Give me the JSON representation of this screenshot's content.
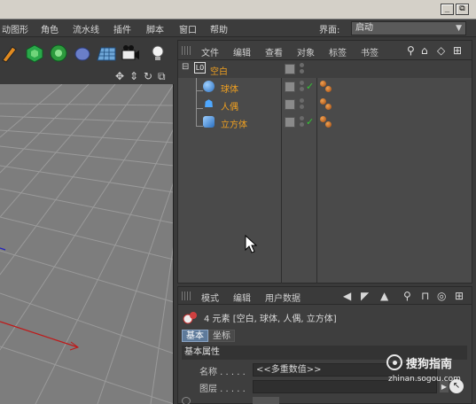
{
  "window": {
    "minimize_label": "_",
    "restore_label": "⧉"
  },
  "menu": {
    "items": [
      "动图形",
      "角色",
      "流水线",
      "插件",
      "脚本",
      "窗口",
      "帮助"
    ],
    "layout_label": "界面:",
    "layout_value": "启动"
  },
  "object_manager": {
    "menu": [
      "文件",
      "编辑",
      "查看",
      "对象",
      "标签",
      "书签"
    ],
    "objects": [
      {
        "name": "空白",
        "level": 0,
        "icon": "null-object-icon"
      },
      {
        "name": "球体",
        "level": 1,
        "icon": "sphere-icon"
      },
      {
        "name": "人偶",
        "level": 1,
        "icon": "figure-icon"
      },
      {
        "name": "立方体",
        "level": 1,
        "icon": "cube-icon"
      }
    ],
    "null_badge": "L0"
  },
  "attribute_manager": {
    "menu": [
      "模式",
      "编辑",
      "用户数据"
    ],
    "element_summary": "4 元素 [空白, 球体, 人偶, 立方体]",
    "tabs": [
      "基本",
      "坐标"
    ],
    "section_title": "基本属性",
    "fields": [
      {
        "label": "名称 . . . . .",
        "value": "<<多重数值>>"
      },
      {
        "label": "图层 . . . . .",
        "value": ""
      }
    ]
  },
  "watermark": {
    "title": "搜狗指南",
    "url": "zhinan.sogou.com"
  },
  "colors": {
    "accent_orange": "#f0a020",
    "selection_tab": "#5e7a9a",
    "check_green": "#34c534"
  }
}
